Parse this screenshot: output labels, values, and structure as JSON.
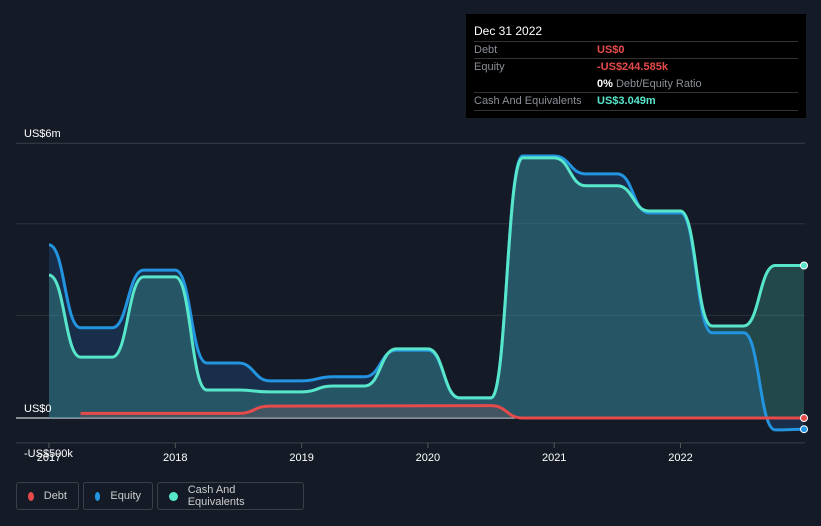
{
  "tooltip": {
    "date": "Dec 31 2022",
    "debt_label": "Debt",
    "debt_value": "US$0",
    "equity_label": "Equity",
    "equity_value": "-US$244.585k",
    "ratio_value": "0%",
    "ratio_label": "Debt/Equity Ratio",
    "cash_label": "Cash And Equivalents",
    "cash_value": "US$3.049m"
  },
  "chart_data": {
    "type": "area",
    "y_ticks": [
      {
        "value": 6,
        "label": "US$6m"
      },
      {
        "value": 0,
        "label": "US$0"
      },
      {
        "value": -0.5,
        "label": "-US$500k"
      }
    ],
    "x_ticks": [
      2017,
      2018,
      2019,
      2020,
      2021,
      2022
    ],
    "x_tick_labels": [
      "2017",
      "2018",
      "2019",
      "2020",
      "2021",
      "2022"
    ],
    "xlim": [
      2016.75,
      2023.0
    ],
    "ylim": [
      -0.55,
      6.0
    ],
    "y_unit": "US$ millions",
    "legend": [
      "Debt",
      "Equity",
      "Cash And Equivalents"
    ],
    "legend_position": "bottom-left",
    "series": [
      {
        "name": "Equity",
        "color": "#2394df",
        "x": [
          2017,
          2017.25,
          2017.5,
          2017.75,
          2018,
          2018.25,
          2018.5,
          2018.75,
          2019,
          2019.25,
          2019.5,
          2019.75,
          2020,
          2020.25,
          2020.5,
          2020.75,
          2021,
          2021.25,
          2021.5,
          2021.75,
          2022,
          2022.25,
          2022.5,
          2022.75,
          2023
        ],
        "values": [
          3.78,
          1.97,
          1.97,
          3.23,
          3.23,
          1.2,
          1.2,
          0.81,
          0.81,
          0.9,
          0.9,
          1.48,
          1.48,
          0.44,
          0.44,
          5.72,
          5.72,
          5.33,
          5.33,
          4.48,
          4.48,
          1.86,
          1.86,
          -0.26,
          -0.245
        ]
      },
      {
        "name": "Cash And Equivalents",
        "color": "#58e6cb",
        "x": [
          2017,
          2017.25,
          2017.5,
          2017.75,
          2018,
          2018.25,
          2018.5,
          2018.75,
          2019,
          2019.25,
          2019.5,
          2019.75,
          2020,
          2020.25,
          2020.5,
          2020.75,
          2021,
          2021.25,
          2021.5,
          2021.75,
          2022,
          2022.25,
          2022.5,
          2022.75,
          2023
        ],
        "values": [
          3.12,
          1.33,
          1.33,
          3.08,
          3.08,
          0.61,
          0.61,
          0.57,
          0.57,
          0.7,
          0.7,
          1.51,
          1.51,
          0.44,
          0.44,
          5.68,
          5.68,
          5.07,
          5.07,
          4.52,
          4.52,
          2.01,
          2.01,
          3.33,
          3.33
        ]
      },
      {
        "name": "Debt",
        "color": "#e64b4b",
        "x": [
          2017.25,
          2018.5,
          2018.75,
          2020.5,
          2020.75,
          2023
        ],
        "values": [
          0.1,
          0.1,
          0.26,
          0.27,
          0,
          0
        ]
      }
    ]
  },
  "legend": [
    {
      "label": "Debt",
      "color": "#e64b4b"
    },
    {
      "label": "Equity",
      "color": "#2394df"
    },
    {
      "label": "Cash And Equivalents",
      "color": "#58e6cb"
    }
  ]
}
